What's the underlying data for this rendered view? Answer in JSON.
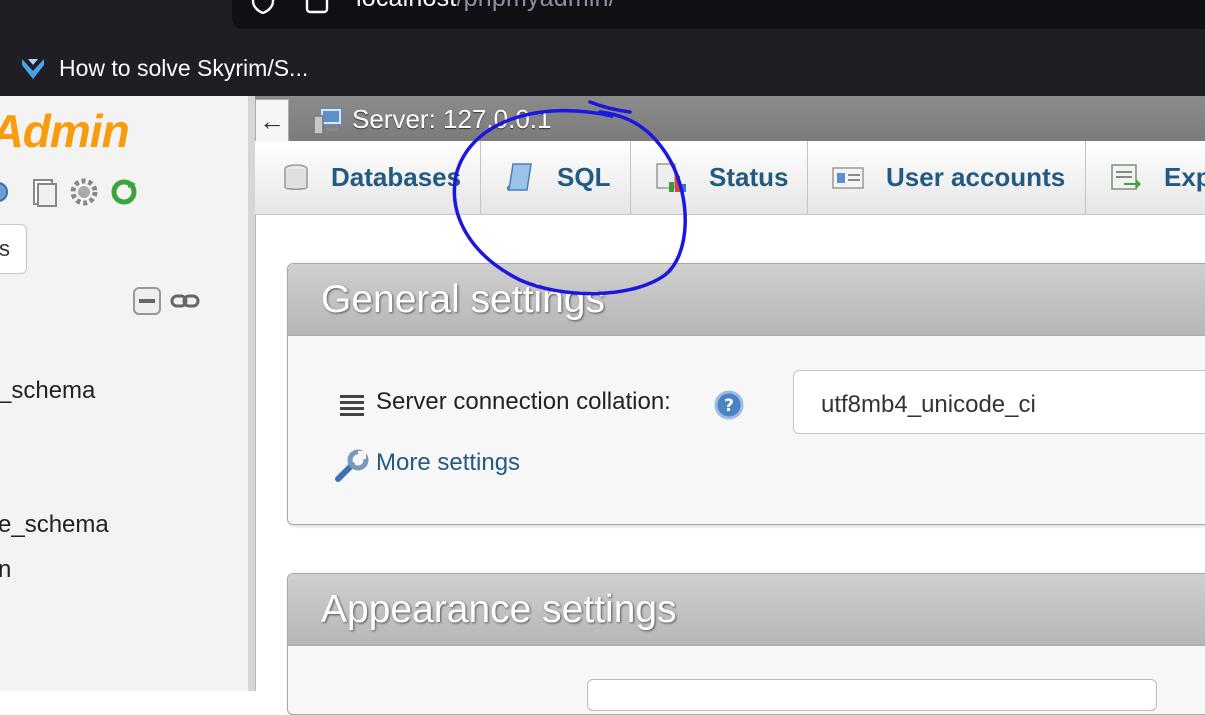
{
  "browser": {
    "url_host": "localhost",
    "url_path": "/phpmyadmin/",
    "bookmark": "How to solve Skyrim/S..."
  },
  "nav": {
    "logo_text": "yAdmin",
    "tab_partial": "s",
    "databases": [
      "_schema",
      "e_schema",
      "n"
    ]
  },
  "server_bar": {
    "back": "←",
    "label": "Server: 127.0.0.1"
  },
  "tabs": [
    {
      "label": "Databases",
      "icon": "database-icon"
    },
    {
      "label": "SQL",
      "icon": "sql-icon"
    },
    {
      "label": "Status",
      "icon": "status-icon"
    },
    {
      "label": "User accounts",
      "icon": "user-accounts-icon"
    },
    {
      "label": "Exp",
      "icon": "export-icon"
    }
  ],
  "general": {
    "title": "General settings",
    "collation_label": "Server connection collation:",
    "collation_value": "utf8mb4_unicode_ci",
    "more_settings": "More settings"
  },
  "appearance": {
    "title": "Appearance settings"
  },
  "colors": {
    "link": "#235a81",
    "logo": "#f89c0e",
    "annotation": "#1a17e0"
  }
}
